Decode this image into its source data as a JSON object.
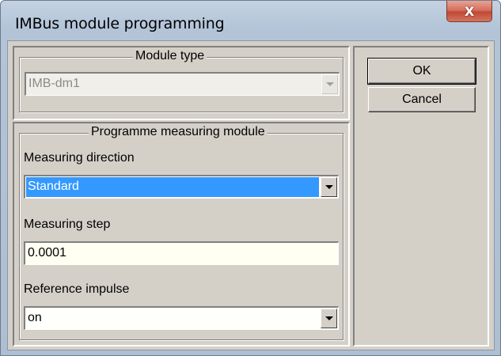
{
  "window": {
    "title": "IMBus module programming",
    "close_glyph": "X"
  },
  "module_type": {
    "legend": "Module type",
    "selected": "IMB-dm1",
    "enabled": false
  },
  "programme": {
    "legend": "Programme measuring module",
    "measuring_direction": {
      "label": "Measuring direction",
      "selected": "Standard"
    },
    "measuring_step": {
      "label": "Measuring step",
      "value": "0.0001"
    },
    "reference_impulse": {
      "label": "Reference impulse",
      "selected": "on"
    }
  },
  "buttons": {
    "ok": "OK",
    "cancel": "Cancel"
  },
  "colors": {
    "selection": "#3399ff",
    "dialog_face": "#d4d0c8",
    "close_button": "#c04a36"
  }
}
